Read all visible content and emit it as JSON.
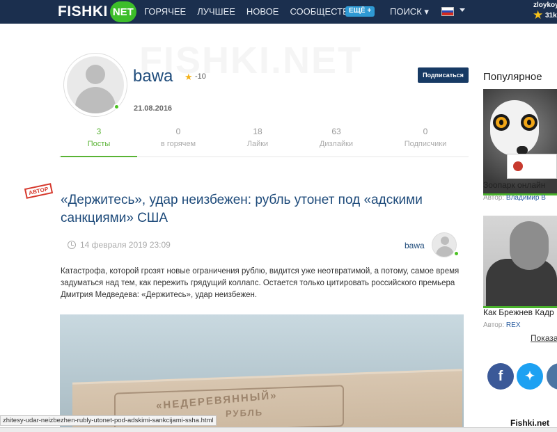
{
  "nav": {
    "logo_text": "FISHKI",
    "logo_suffix": "NET",
    "items": [
      "ГОРЯЧЕЕ",
      "ЛУЧШЕЕ",
      "НОВОЕ",
      "СООБЩЕСТВА"
    ],
    "more_label": "ЕЩЁ +",
    "search_label": "ПОИСК ▾",
    "user": "zloykoy",
    "user_score": "31k",
    "flag_colors": [
      "#ffffff",
      "#2a4bb8",
      "#d52b1e"
    ]
  },
  "background_text": "FISHKI.NET",
  "profile": {
    "username": "bawa",
    "rating": "-10",
    "join_date": "21.08.2016",
    "subscribe_label": "Подписаться",
    "stats": [
      {
        "count": "3",
        "label": "Посты"
      },
      {
        "count": "0",
        "label": "в горячем"
      },
      {
        "count": "18",
        "label": "Лайки"
      },
      {
        "count": "63",
        "label": "Дизлайки"
      },
      {
        "count": "0",
        "label": "Подписчики"
      }
    ]
  },
  "article": {
    "stamp": "АВТОР",
    "title": "«Держитесь», удар неизбежен: рубль утонет под «адскими санкциями» США",
    "date": "14 февраля 2019 23:09",
    "author": "bawa",
    "lead": "Катастрофа, которой грозят новые ограничения рублю, видится уже неотвратимой, а потому, самое время задуматься над тем, как пережить грядущий коллапс. Остается только цитировать российского премьера Дмитрия Медведева: «Держитесь», удар неизбежен.",
    "image_text_1": "«НЕДЕРЕВЯННЫЙ»",
    "image_text_2": "РУБЛЬ"
  },
  "sidebar": {
    "title": "Популярное",
    "cards": [
      {
        "title": "Зоопарк онлайн",
        "author_prefix": "Автор:",
        "author": "Владимир В"
      },
      {
        "title": "Как Брежнев Кадр",
        "author_prefix": "Автор:",
        "author": "REX"
      }
    ],
    "show_more": "Показа",
    "social": [
      {
        "icon": "facebook-icon",
        "glyph": "f",
        "color": "#3b5998"
      },
      {
        "icon": "twitter-icon",
        "glyph": "🐦",
        "color": "#1da1f2"
      },
      {
        "icon": "vk-icon",
        "glyph": "",
        "color": "#4c75a3"
      }
    ]
  },
  "status_url": "zhitesy-udar-neizbezhen-rubly-utonet-pod-adskimi-sankcijami-ssha.html",
  "watermark": "Fishki.net"
}
